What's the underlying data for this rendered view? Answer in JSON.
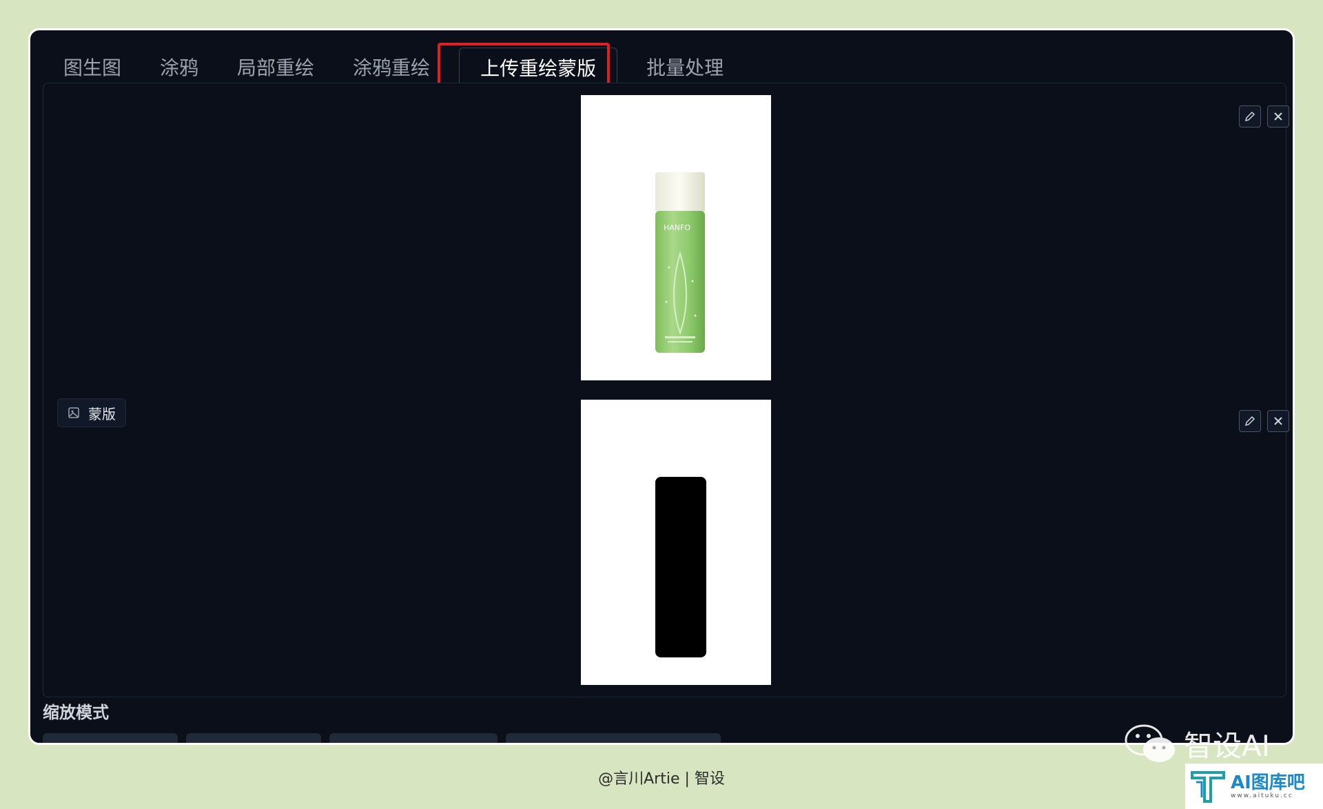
{
  "tabs": [
    {
      "label": "图生图"
    },
    {
      "label": "涂鸦"
    },
    {
      "label": "局部重绘"
    },
    {
      "label": "涂鸦重绘"
    },
    {
      "label": "上传重绘蒙版"
    },
    {
      "label": "批量处理"
    }
  ],
  "active_tab": "上传重绘蒙版",
  "mask_label": "蒙版",
  "scale_mode_title": "缩放模式",
  "product_image": {
    "brand_text": "HANFO"
  },
  "footer": {
    "credit": "@言川Artie | 智设"
  },
  "watermark": {
    "text": "智设AI"
  },
  "logo": {
    "title": "AI图库吧",
    "url": "www.aituku.cc"
  },
  "colors": {
    "highlight": "#e02020",
    "background": "#d7e6c1",
    "app_bg": "#0b0f19"
  },
  "icons": [
    "pencil-icon",
    "close-icon",
    "image-icon",
    "wechat-icon"
  ]
}
